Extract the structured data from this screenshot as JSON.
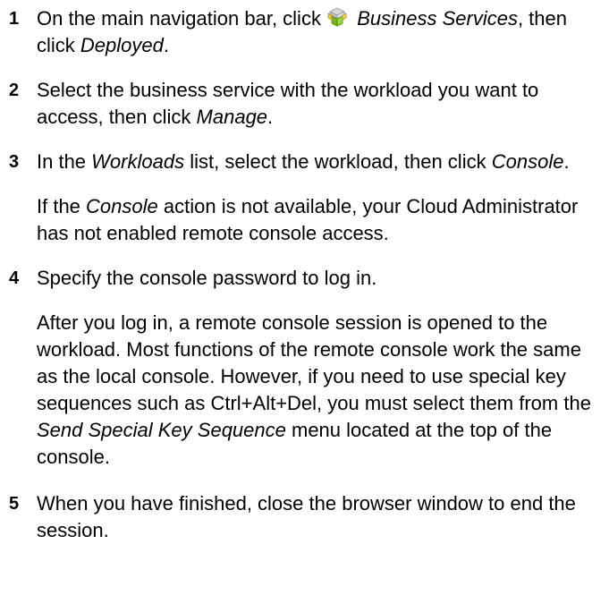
{
  "steps": [
    {
      "number": "1",
      "text_a": "On the main navigation bar, click",
      "icon": "business-services-icon",
      "em_a": "Business Services",
      "text_b": ", then click",
      "em_b": "Deployed",
      "text_c": "."
    },
    {
      "number": "2",
      "text_a": "Select the business service with the workload you want to access, then click",
      "em_a": "Manage",
      "text_b": "."
    },
    {
      "number": "3",
      "text_a": "In the",
      "em_a": "Workloads",
      "text_b": "list, select the workload, then click",
      "em_b": "Console",
      "text_c": ".",
      "note_a": "If the",
      "note_em": "Console",
      "note_b": "action is not available, your Cloud Administrator has not enabled remote console access."
    },
    {
      "number": "4",
      "text_a": "Specify the console password to log in.",
      "note_a": "After you log in, a remote console session is opened to the workload. Most functions of the remote console work the same as the local console. However, if you need to use special key sequences such as Ctrl+Alt+Del, you must select them from the",
      "note_em": "Send Special Key Sequence",
      "note_b": "menu located at the top of the console."
    },
    {
      "number": "5",
      "text_a": "When you have finished, close the browser window to end the session."
    }
  ],
  "colors": {
    "text": "#000000",
    "icon_green": "#7cc21e",
    "icon_yellow": "#e8c61c",
    "icon_gray": "#c9c9c9"
  }
}
